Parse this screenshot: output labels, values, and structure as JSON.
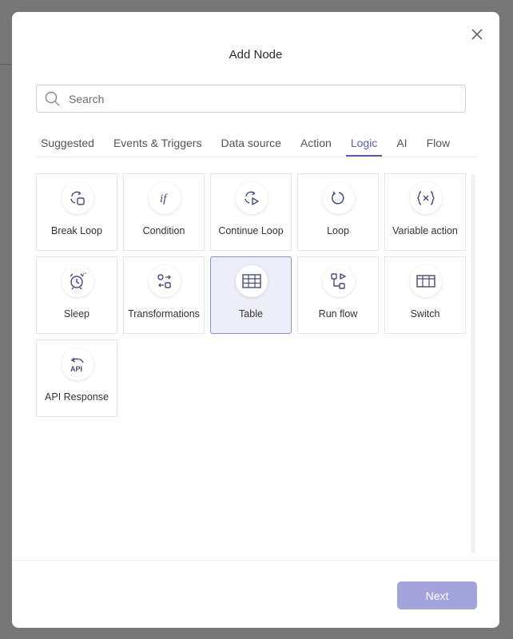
{
  "modal": {
    "title": "Add Node",
    "next_label": "Next"
  },
  "search": {
    "placeholder": "Search"
  },
  "tabs": [
    {
      "label": "Suggested"
    },
    {
      "label": "Events & Triggers"
    },
    {
      "label": "Data source"
    },
    {
      "label": "Action"
    },
    {
      "label": "Logic",
      "active": true
    },
    {
      "label": "AI"
    },
    {
      "label": "Flow"
    }
  ],
  "nodes": [
    {
      "label": "Break Loop",
      "icon": "break-loop-icon"
    },
    {
      "label": "Condition",
      "icon": "condition-if-icon"
    },
    {
      "label": "Continue Loop",
      "icon": "continue-loop-icon"
    },
    {
      "label": "Loop",
      "icon": "loop-icon"
    },
    {
      "label": "Variable action",
      "icon": "variable-icon"
    },
    {
      "label": "Sleep",
      "icon": "alarm-clock-icon"
    },
    {
      "label": "Transformations",
      "icon": "transformations-icon"
    },
    {
      "label": "Table",
      "icon": "table-icon",
      "selected": true
    },
    {
      "label": "Run flow",
      "icon": "run-flow-icon"
    },
    {
      "label": "Switch",
      "icon": "switch-icon"
    },
    {
      "label": "API Response",
      "icon": "api-response-icon"
    }
  ],
  "colors": {
    "accent": "#5b5bb5",
    "next_button": "#a4a4dc",
    "selected_card_bg": "#eeeefa",
    "icon_stroke": "#4a4a7a"
  }
}
